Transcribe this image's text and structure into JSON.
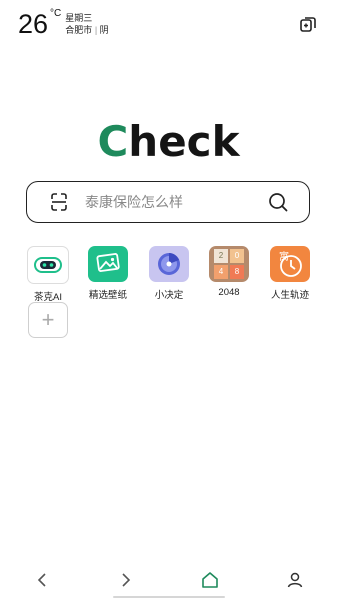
{
  "weather": {
    "temperature": "26",
    "unit": "°C",
    "weekday": "星期三",
    "location": "合肥市",
    "separator": "|",
    "condition": "阴"
  },
  "top_right_icon": "window-switch-icon",
  "logo": {
    "first_letter": "C",
    "rest": "heck"
  },
  "search": {
    "placeholder": "泰康保险怎么样",
    "left_icon": "scan-icon",
    "right_icon": "search-icon"
  },
  "apps": [
    {
      "label": "茶克AI",
      "icon": "robot-icon"
    },
    {
      "label": "精选壁纸",
      "icon": "wallpaper-icon"
    },
    {
      "label": "小决定",
      "icon": "spinner-wheel-icon"
    },
    {
      "label": "2048",
      "icon": "2048-game-icon",
      "tiles": [
        "2",
        "0",
        "4",
        "8"
      ]
    },
    {
      "label": "人生轨迹",
      "icon": "clock-icon",
      "glyph": "寓"
    }
  ],
  "add_app": {
    "symbol": "+"
  },
  "bottom_nav": [
    "back-icon",
    "forward-icon",
    "home-icon",
    "profile-icon"
  ],
  "colors": {
    "brand_green": "#1e8a5c",
    "wallpaper_green": "#1fbf8b",
    "decision_purple": "#c8c5f0",
    "tile_brown": "#b58a6b",
    "orange": "#f2863f"
  }
}
